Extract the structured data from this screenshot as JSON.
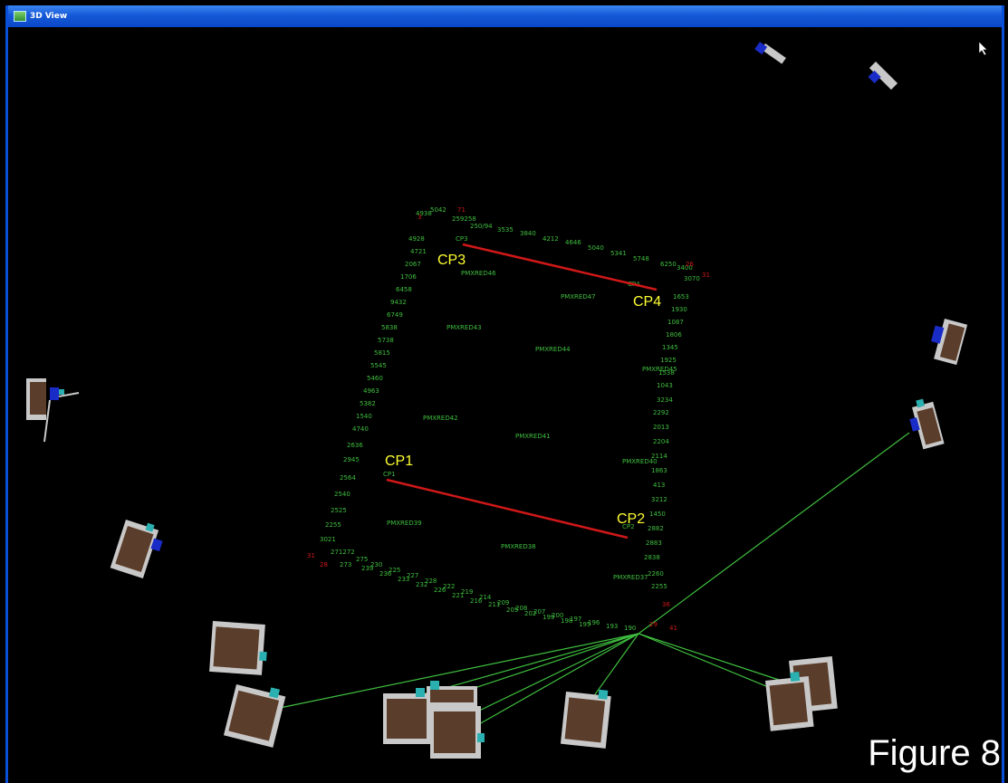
{
  "window": {
    "title": "3D View",
    "icon": "app-3d-view-icon"
  },
  "viewport": {
    "background": "#000000",
    "point_color": "#3fbf3f",
    "ray_color": "#3fbf3f",
    "scale_bar_color": "#d01818",
    "callout_color": "#ffff33"
  },
  "scale_bars": [
    {
      "label_from": "CP1",
      "label_to": "CP2"
    },
    {
      "label_from": "CP3",
      "label_to": "CP4"
    }
  ],
  "callouts": {
    "cp1": "CP1",
    "cp2": "CP2",
    "cp3": "CP3",
    "cp4": "CP4"
  },
  "targets": [
    "PMXRED46",
    "PMXRED47",
    "PMXRED43",
    "PMXRED44",
    "PMXRED45",
    "PMXRED42",
    "PMXRED41",
    "PMXRED40",
    "PMXRED39",
    "PMXRED38",
    "PMXRED37"
  ],
  "cameras": {
    "count": 16,
    "icon": "camera-station-icon"
  },
  "figure_caption": "Figure 8"
}
